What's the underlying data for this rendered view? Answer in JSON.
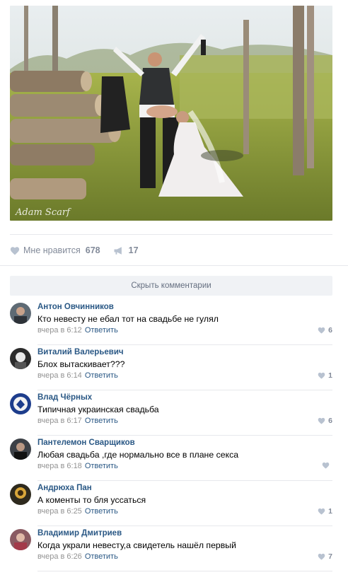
{
  "post": {
    "photo": {
      "watermark": "Adam Scarf"
    },
    "actions": {
      "like_label": "Мне нравится",
      "like_count": "678",
      "share_count": "17"
    }
  },
  "hide_comments_label": "Скрыть комментарии",
  "comments": [
    {
      "author": "Антон Овчинников",
      "text": "Кто невесту не ебал тот на свадьбе не гулял",
      "time": "вчера в 6:12",
      "reply": "Ответить",
      "likes": "6"
    },
    {
      "author": "Виталий Валерьевич",
      "text": "Блох вытаскивает???",
      "time": "вчера в 6:14",
      "reply": "Ответить",
      "likes": "1"
    },
    {
      "author": "Влад Чёрных",
      "text": "Типичная украинская свадьба",
      "time": "вчера в 6:17",
      "reply": "Ответить",
      "likes": "6"
    },
    {
      "author": "Пантелемон Сварщиков",
      "text": "Любая свадьба ,где нормально все в плане секса",
      "time": "вчера в 6:18",
      "reply": "Ответить",
      "likes": ""
    },
    {
      "author": "Андрюха Пан",
      "text": "А коменты то бля уссаться",
      "time": "вчера в 6:25",
      "reply": "Ответить",
      "likes": "1"
    },
    {
      "author": "Владимир Дмитриев",
      "text": "Когда украли невесту,а свидетель нашёл первый",
      "time": "вчера в 6:26",
      "reply": "Ответить",
      "likes": "7"
    }
  ],
  "colors": {
    "link": "#2a5885",
    "meta": "#939393",
    "icon": "#b8c2d0",
    "bar": "#f0f2f5"
  }
}
